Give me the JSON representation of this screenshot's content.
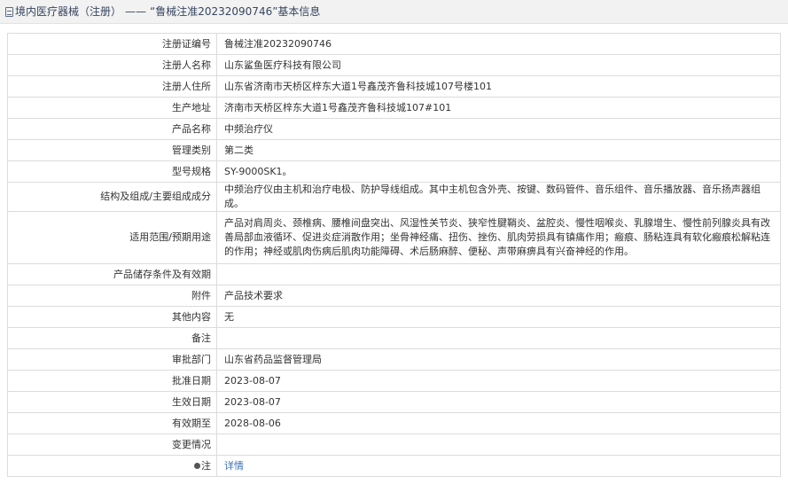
{
  "header": {
    "breadcrumb": "境内医疗器械（注册）",
    "separator": "——",
    "title": "“鲁械注准20232090746”基本信息"
  },
  "rows": [
    {
      "label": "注册证编号",
      "value": "鲁械注准20232090746"
    },
    {
      "label": "注册人名称",
      "value": "山东鲨鱼医疗科技有限公司"
    },
    {
      "label": "注册人住所",
      "value": "山东省济南市天桥区梓东大道1号鑫茂齐鲁科技城107号楼101"
    },
    {
      "label": "生产地址",
      "value": "济南市天桥区梓东大道1号鑫茂齐鲁科技城107#101"
    },
    {
      "label": "产品名称",
      "value": "中频治疗仪"
    },
    {
      "label": "管理类别",
      "value": "第二类"
    },
    {
      "label": "型号规格",
      "value": "SY-9000SK1。"
    },
    {
      "label": "结构及组成/主要组成成分",
      "value": "中频治疗仪由主机和治疗电极、防护导线组成。其中主机包含外壳、按键、数码管件、音乐组件、音乐播放器、音乐扬声器组成。"
    },
    {
      "label": "适用范围/预期用途",
      "value": "产品对肩周炎、颈椎病、腰椎间盘突出、风湿性关节炎、狭窄性腱鞘炎、盆腔炎、慢性咽喉炎、乳腺增生、慢性前列腺炎具有改善局部血液循环、促进炎症消散作用；坐骨神经痛、扭伤、挫伤、肌肉劳损具有镇痛作用；瘢痕、肠粘连具有软化瘢痕松解粘连的作用；神经或肌肉伤病后肌肉功能障碍、术后肠麻醉、便秘、声带麻痹具有兴奋神经的作用。"
    },
    {
      "label": "产品储存条件及有效期",
      "value": ""
    },
    {
      "label": "附件",
      "value": "产品技术要求"
    },
    {
      "label": "其他内容",
      "value": "无"
    },
    {
      "label": "备注",
      "value": ""
    },
    {
      "label": "审批部门",
      "value": "山东省药品监督管理局"
    },
    {
      "label": "批准日期",
      "value": "2023-08-07"
    },
    {
      "label": "生效日期",
      "value": "2023-08-07"
    },
    {
      "label": "有效期至",
      "value": "2028-08-06"
    },
    {
      "label": "变更情况",
      "value": ""
    }
  ],
  "note_row": {
    "label": "注",
    "link_text": "详情"
  },
  "colors": {
    "link": "#3a6fb5",
    "border": "#dcdcdc",
    "header_bg": "#f2f2f2"
  }
}
